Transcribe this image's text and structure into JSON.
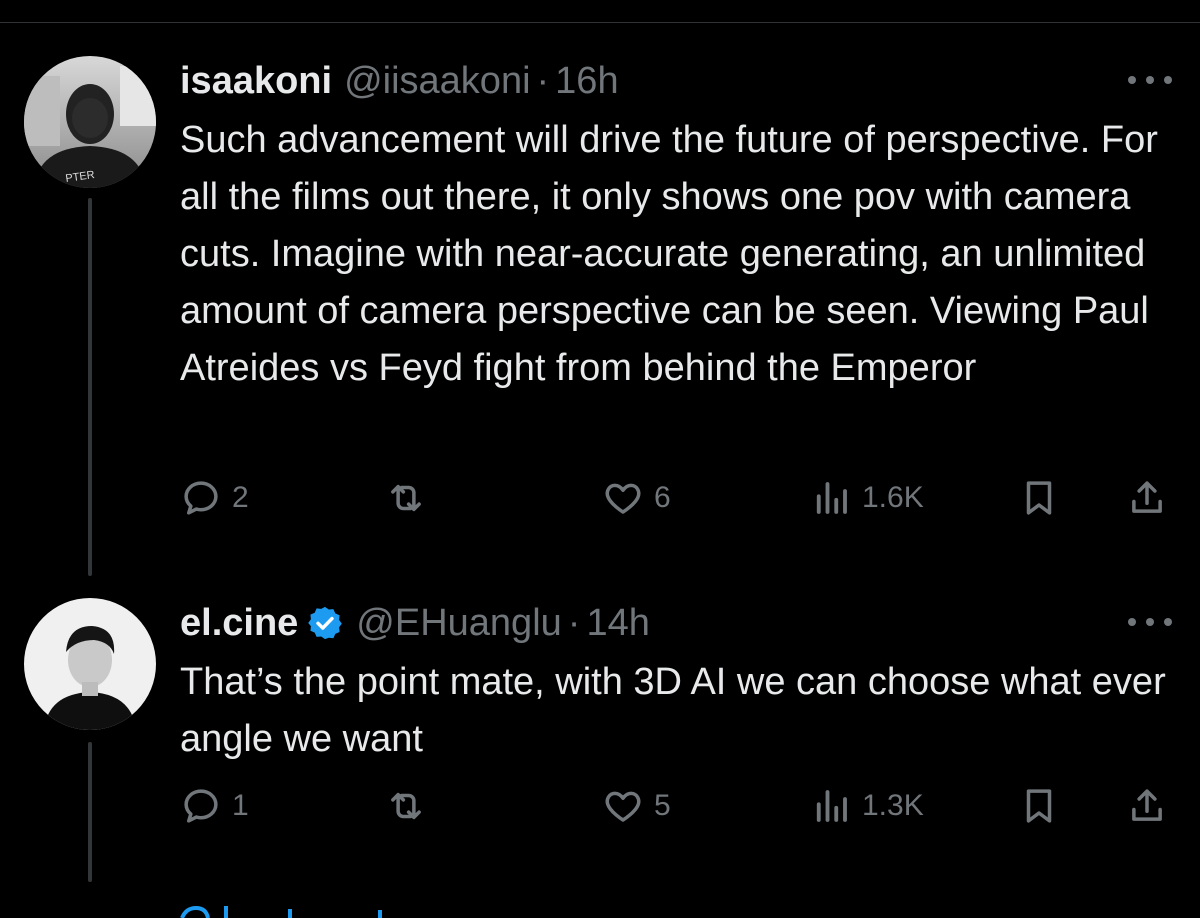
{
  "tweets": [
    {
      "display_name": "isaakoni",
      "handle": "@iisaakoni",
      "separator": "·",
      "time": "16h",
      "verified": false,
      "text": "Such advancement will drive the future of perspective. For all the films out there, it only shows one pov with camera cuts. Imagine with near-accurate generating, an unlimited amount of camera perspective can be seen.  Viewing Paul Atreides vs Feyd fight from behind the Emperor",
      "avatar_shirt_text": "PTER",
      "replies": "2",
      "likes": "6",
      "views": "1.6K"
    },
    {
      "display_name": "el.cine",
      "handle": "@EHuanglu",
      "separator": "·",
      "time": "14h",
      "verified": true,
      "text": "That’s the point mate, with 3D AI we can choose what ever angle we want",
      "replies": "1",
      "likes": "5",
      "views": "1.3K"
    }
  ],
  "colors": {
    "background": "#000000",
    "text_primary": "#e7e9ea",
    "text_secondary": "#71767b",
    "verified_blue": "#1d9bf0",
    "thread_line": "#333639"
  },
  "icons": [
    "reply-icon",
    "retweet-icon",
    "like-icon",
    "views-icon",
    "bookmark-icon",
    "share-icon",
    "more-icon",
    "verified-badge-icon"
  ]
}
